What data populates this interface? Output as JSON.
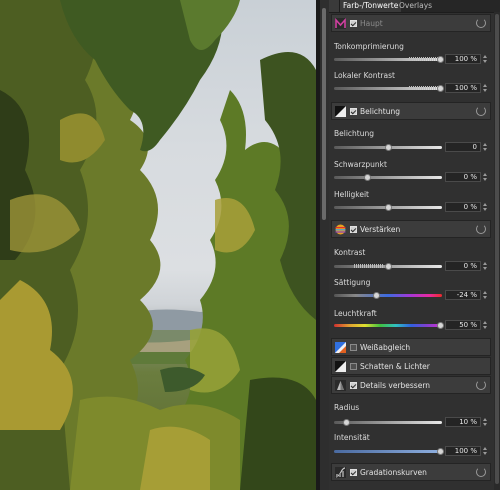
{
  "tabs": [
    "Farb-/Tonwerte",
    "Overlays"
  ],
  "sections": {
    "haupt": {
      "title": "Haupt",
      "checked": true,
      "dim": true
    },
    "belichtung_section": {
      "title": "Belichtung",
      "checked": true
    },
    "verstaerken": {
      "title": "Verstärken",
      "checked": true
    },
    "weissabgleich": {
      "title": "Weißabgleich",
      "checked": false
    },
    "schatten": {
      "title": "Schatten & Lichter",
      "checked": false
    },
    "details": {
      "title": "Details verbessern",
      "checked": true
    },
    "gradation": {
      "title": "Gradationskurven",
      "checked": true
    }
  },
  "sliders": {
    "tonkompression": {
      "label": "Tonkomprimierung",
      "value": "100 %",
      "level": 1.0
    },
    "lokaler_kontrast": {
      "label": "Lokaler Kontrast",
      "value": "100 %",
      "level": 1.0
    },
    "belichtung": {
      "label": "Belichtung",
      "value": "0",
      "level": 0.5
    },
    "schwarzpunkt": {
      "label": "Schwarzpunkt",
      "value": "0 %",
      "level": 0.32
    },
    "helligkeit": {
      "label": "Helligkeit",
      "value": "0 %",
      "level": 0.5
    },
    "kontrast": {
      "label": "Kontrast",
      "value": "0 %",
      "level": 0.5
    },
    "saettigung": {
      "label": "Sättigung",
      "value": "-24 %",
      "level": 0.38
    },
    "leuchtkraft": {
      "label": "Leuchtkraft",
      "value": "50 %",
      "level": 1.0
    },
    "radius": {
      "label": "Radius",
      "value": "10 %",
      "level": 0.1
    },
    "intensitaet": {
      "label": "Intensität",
      "value": "100 %",
      "level": 1.0
    }
  }
}
